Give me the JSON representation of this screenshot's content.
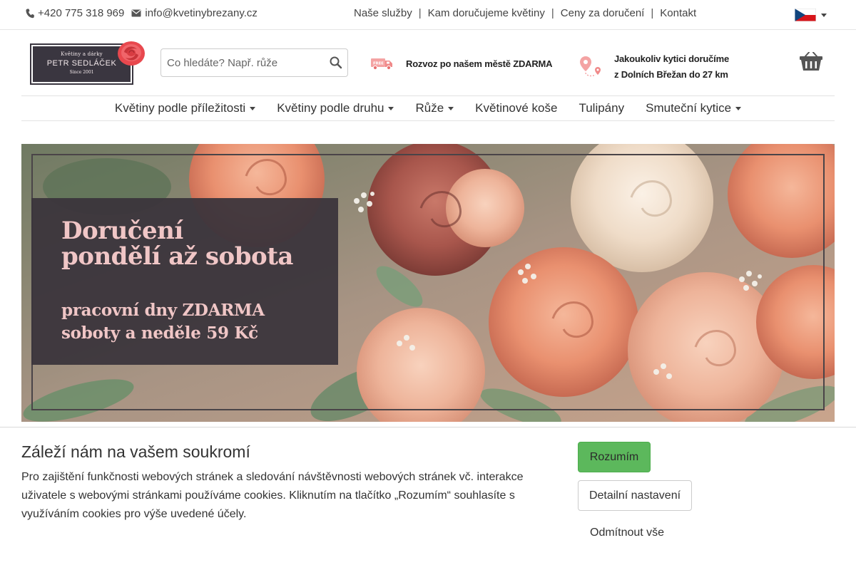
{
  "topbar": {
    "phone": "+420 775 318 969",
    "email": "info@kvetinybrezany.cz",
    "links": [
      "Naše služby",
      "Kam doručujeme květiny",
      "Ceny za doručení",
      "Kontakt"
    ],
    "separator": "|",
    "language_icon": "czech-flag-icon"
  },
  "logo": {
    "line1": "Květiny a dárky",
    "line2": "PETR SEDLÁČEK",
    "line3": "Since 2001"
  },
  "search": {
    "placeholder": "Co hledáte? Např. růže",
    "icon": "search-icon"
  },
  "promos": {
    "free_delivery": "Rozvoz po našem městě ZDARMA",
    "free_badge": "FREE",
    "distance_line1": "Jakoukoliv kytici doručíme",
    "distance_line2": "z Dolních Břežan do 27 km"
  },
  "nav": [
    {
      "label": "Květiny podle příležitosti",
      "dropdown": true
    },
    {
      "label": "Květiny podle druhu",
      "dropdown": true
    },
    {
      "label": "Růže",
      "dropdown": true
    },
    {
      "label": "Květinové koše",
      "dropdown": false
    },
    {
      "label": "Tulipány",
      "dropdown": false
    },
    {
      "label": "Smuteční kytice",
      "dropdown": true
    }
  ],
  "banner": {
    "heading_line1": "Doručení",
    "heading_line2": "pondělí až sobota",
    "sub_line1": "pracovní dny ZDARMA",
    "sub_line2": "soboty a neděle 59 Kč"
  },
  "cookie": {
    "title": "Záleží nám na vašem soukromí",
    "text": "Pro zajištění funkčnosti webových stránek a sledování návštěvnosti webových stránek vč. interakce uživatele s webovými stránkami používáme cookies. Kliknutím na tlačítko „Rozumím“ souhlasíte s využíváním cookies pro výše uvedené účely.",
    "accept": "Rozumím",
    "settings": "Detailní nastavení",
    "reject": "Odmítnout vše"
  },
  "colors": {
    "accept_green": "#5cb85c",
    "banner_panel": "#3a343c",
    "banner_text_pink": "#f0c6c6",
    "promo_icon": "#f08a8a"
  }
}
